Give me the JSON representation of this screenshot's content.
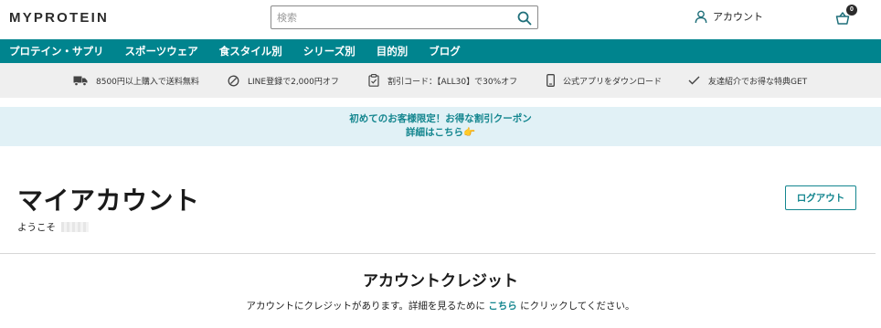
{
  "header": {
    "logo": "MYPROTEIN",
    "search": {
      "placeholder": "検索",
      "value": ""
    },
    "account_label": "アカウント",
    "basket_count": "0"
  },
  "nav": {
    "items": [
      {
        "label": "プロテイン・サプリ"
      },
      {
        "label": "スポーツウェア"
      },
      {
        "label": "食スタイル別"
      },
      {
        "label": "シリーズ別"
      },
      {
        "label": "目的別"
      },
      {
        "label": "ブログ"
      }
    ]
  },
  "usp": {
    "items": [
      {
        "label": "8500円以上購入で送料無料",
        "icon": "truck-icon"
      },
      {
        "label": "LINE登録で2,000円オフ",
        "icon": "discount-icon"
      },
      {
        "label": "割引コード：【ALL30】で30%オフ",
        "icon": "clipboard-icon"
      },
      {
        "label": "公式アプリをダウンロード",
        "icon": "phone-icon"
      },
      {
        "label": "友達紹介でお得な特典GET",
        "icon": "check-icon"
      }
    ]
  },
  "promo": {
    "line1": "初めてのお客様限定！お得な割引クーポン",
    "line2": "詳細はこちら👉"
  },
  "account": {
    "title": "マイアカウント",
    "welcome": "ようこそ",
    "logout_label": "ログアウト"
  },
  "credit": {
    "title": "アカウントクレジット",
    "text_before": "アカウントにクレジットがあります。詳細を見るために ",
    "link": "こちら",
    "text_after": " にクリックしてください。"
  },
  "colors": {
    "brand_teal": "#00848e",
    "link_teal": "#14868f",
    "usp_bg": "#efefef",
    "promo_bg": "#e1f1f6"
  }
}
